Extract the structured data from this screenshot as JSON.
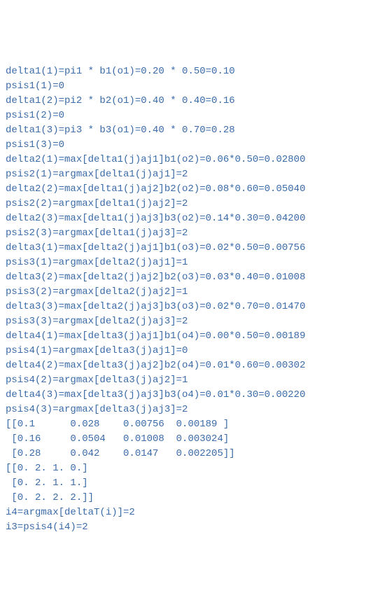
{
  "lines": [
    "delta1(1)=pi1 * b1(o1)=0.20 * 0.50=0.10",
    "psis1(1)=0",
    "delta1(2)=pi2 * b2(o1)=0.40 * 0.40=0.16",
    "psis1(2)=0",
    "delta1(3)=pi3 * b3(o1)=0.40 * 0.70=0.28",
    "psis1(3)=0",
    "delta2(1)=max[delta1(j)aj1]b1(o2)=0.06*0.50=0.02800",
    "psis2(1)=argmax[delta1(j)aj1]=2",
    "delta2(2)=max[delta1(j)aj2]b2(o2)=0.08*0.60=0.05040",
    "psis2(2)=argmax[delta1(j)aj2]=2",
    "delta2(3)=max[delta1(j)aj3]b3(o2)=0.14*0.30=0.04200",
    "psis2(3)=argmax[delta1(j)aj3]=2",
    "delta3(1)=max[delta2(j)aj1]b1(o3)=0.02*0.50=0.00756",
    "psis3(1)=argmax[delta2(j)aj1]=1",
    "delta3(2)=max[delta2(j)aj2]b2(o3)=0.03*0.40=0.01008",
    "psis3(2)=argmax[delta2(j)aj2]=1",
    "delta3(3)=max[delta2(j)aj3]b3(o3)=0.02*0.70=0.01470",
    "psis3(3)=argmax[delta2(j)aj3]=2",
    "delta4(1)=max[delta3(j)aj1]b1(o4)=0.00*0.50=0.00189",
    "psis4(1)=argmax[delta3(j)aj1]=0",
    "delta4(2)=max[delta3(j)aj2]b2(o4)=0.01*0.60=0.00302",
    "psis4(2)=argmax[delta3(j)aj2]=1",
    "delta4(3)=max[delta3(j)aj3]b3(o4)=0.01*0.30=0.00220",
    "psis4(3)=argmax[delta3(j)aj3]=2",
    "[[0.1      0.028    0.00756  0.00189 ]",
    " [0.16     0.0504   0.01008  0.003024]",
    " [0.28     0.042    0.0147   0.002205]]",
    "[[0. 2. 1. 0.]",
    " [0. 2. 1. 1.]",
    " [0. 2. 2. 2.]]",
    "i4=argmax[deltaT(i)]=2",
    "i3=psis4(i4)=2"
  ]
}
